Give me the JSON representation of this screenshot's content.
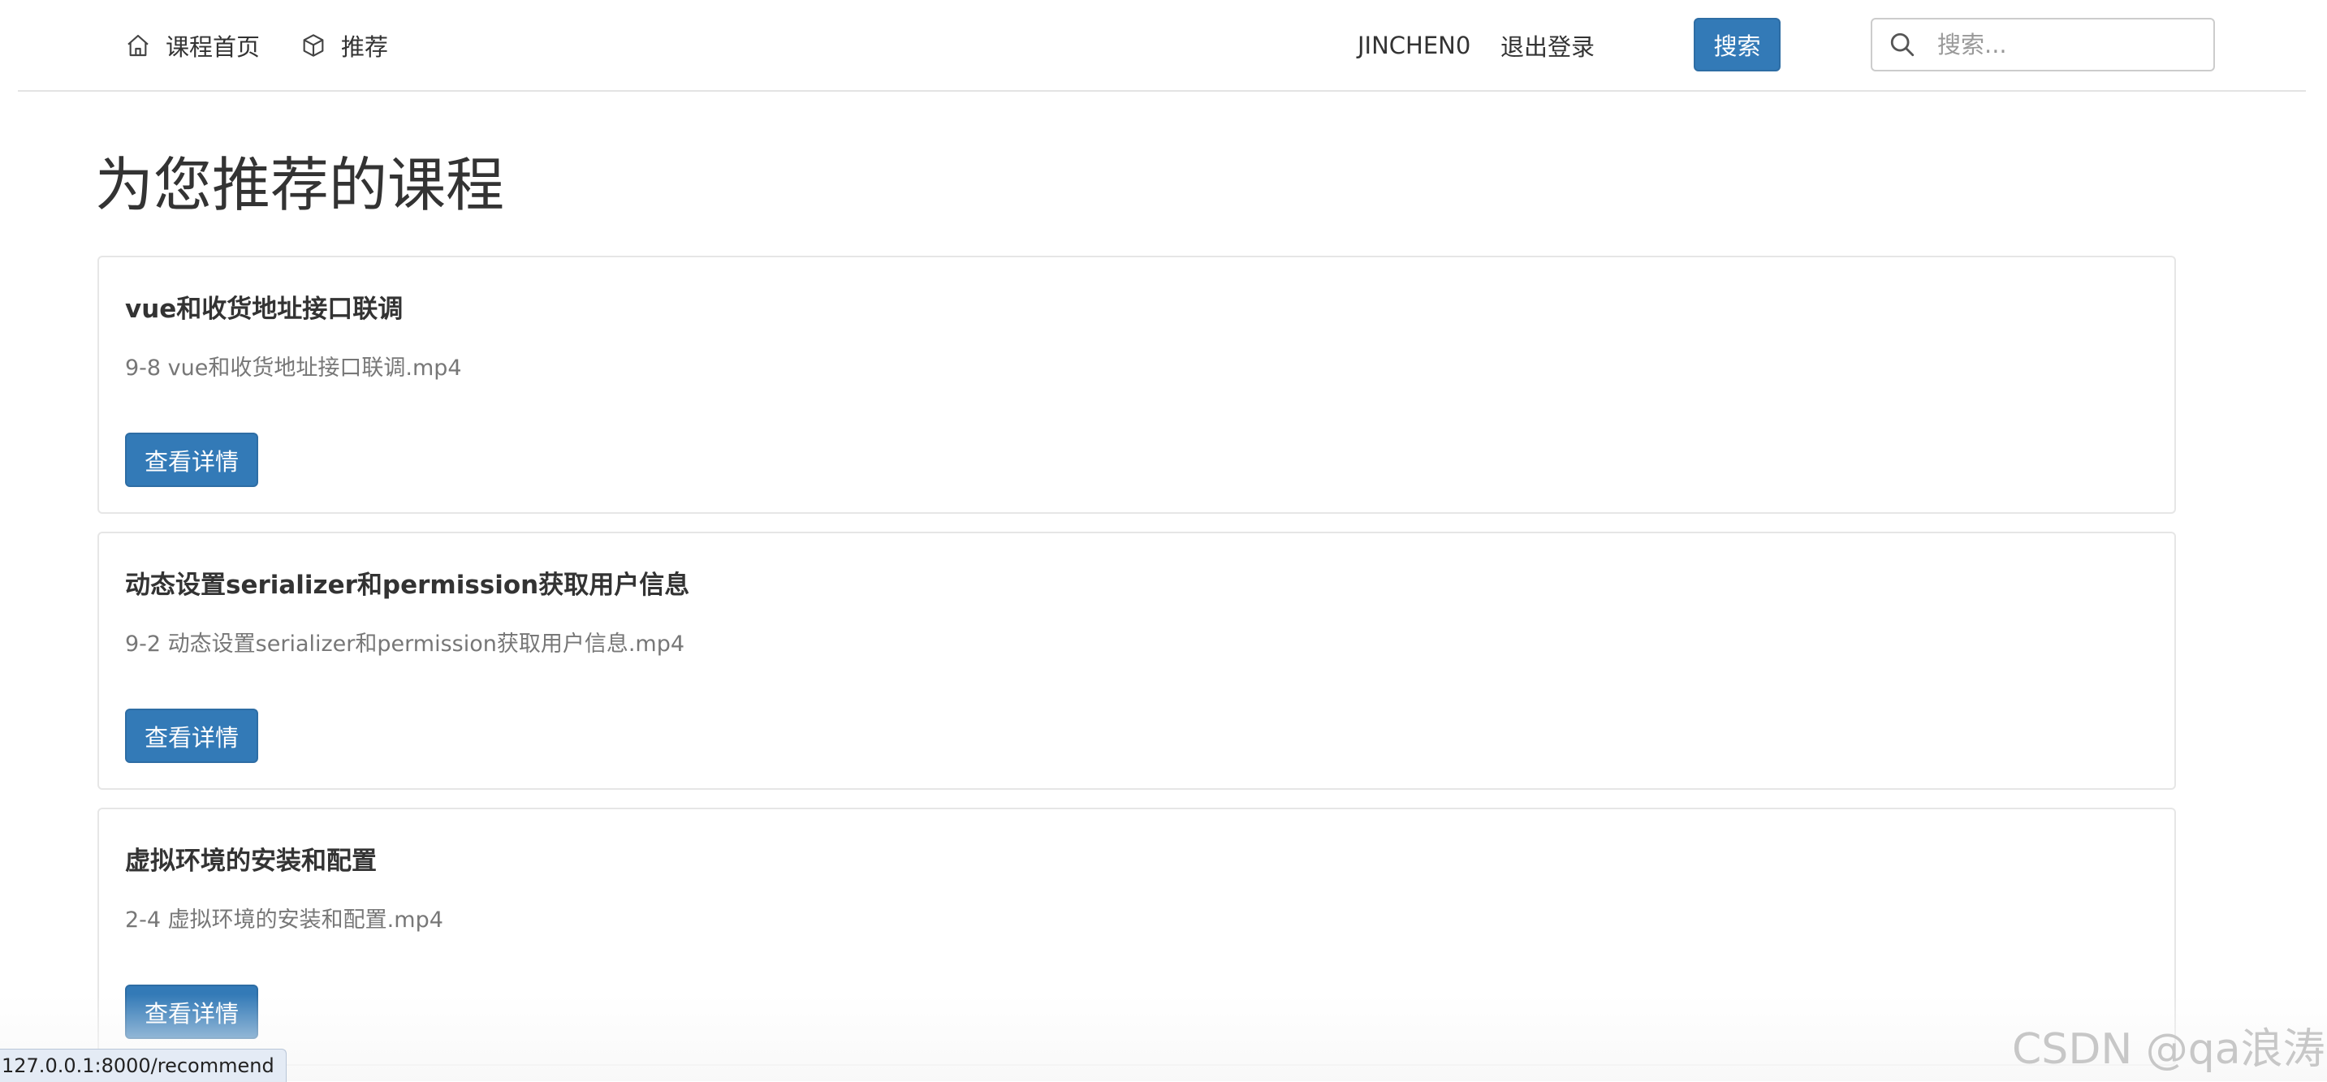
{
  "navbar": {
    "home": {
      "icon": "home-icon",
      "label": "课程首页"
    },
    "recommend": {
      "icon": "cube-icon",
      "label": "推荐"
    },
    "username": "JINCHEN0",
    "logout": "退出登录",
    "search_button": "搜索",
    "search_placeholder": "搜索..."
  },
  "main": {
    "title": "为您推荐的课程",
    "courses": [
      {
        "title": "vue和收货地址接口联调",
        "file": "9-8 vue和收货地址接口联调.mp4",
        "button": "查看详情"
      },
      {
        "title": "动态设置serializer和permission获取用户信息",
        "file": "9-2 动态设置serializer和permission获取用户信息.mp4",
        "button": "查看详情"
      },
      {
        "title": "虚拟环境的安装和配置",
        "file": "2-4 虚拟环境的安装和配置.mp4",
        "button": "查看详情"
      }
    ]
  },
  "status_bar": {
    "url": "127.0.0.1:8000/recommend"
  },
  "watermark": "CSDN @qa浪涛",
  "colors": {
    "primary": "#337ab7",
    "border": "#e6e6e6",
    "muted_text": "#777777"
  }
}
